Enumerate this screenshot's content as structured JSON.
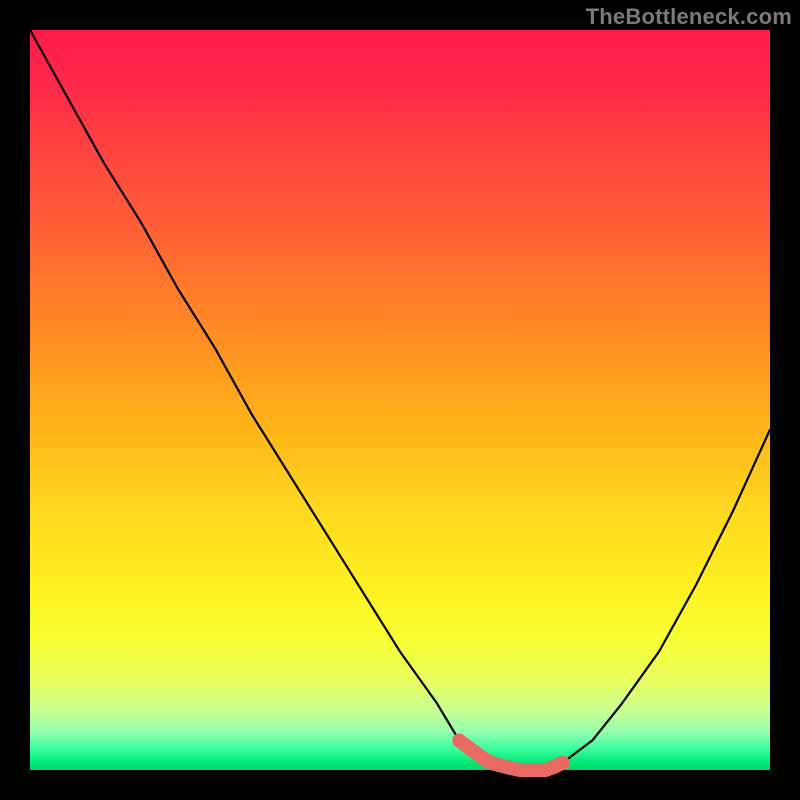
{
  "watermark": "TheBottleneck.com",
  "chart_data": {
    "type": "line",
    "title": "",
    "xlabel": "",
    "ylabel": "",
    "xlim": [
      0,
      100
    ],
    "ylim": [
      0,
      100
    ],
    "grid": false,
    "legend": false,
    "series": [
      {
        "name": "bottleneck-curve",
        "x": [
          0,
          5,
          10,
          15,
          20,
          25,
          30,
          35,
          40,
          45,
          50,
          55,
          58,
          62,
          66,
          70,
          72,
          76,
          80,
          85,
          90,
          95,
          100
        ],
        "values": [
          100,
          91,
          82,
          74,
          65,
          57,
          48,
          40,
          32,
          24,
          16,
          9,
          4,
          1,
          0,
          0,
          1,
          4,
          9,
          16,
          25,
          35,
          46
        ]
      }
    ],
    "annotations": [
      {
        "name": "optimal-range",
        "x_start": 58,
        "x_end": 72,
        "color": "#e86a62"
      }
    ]
  }
}
